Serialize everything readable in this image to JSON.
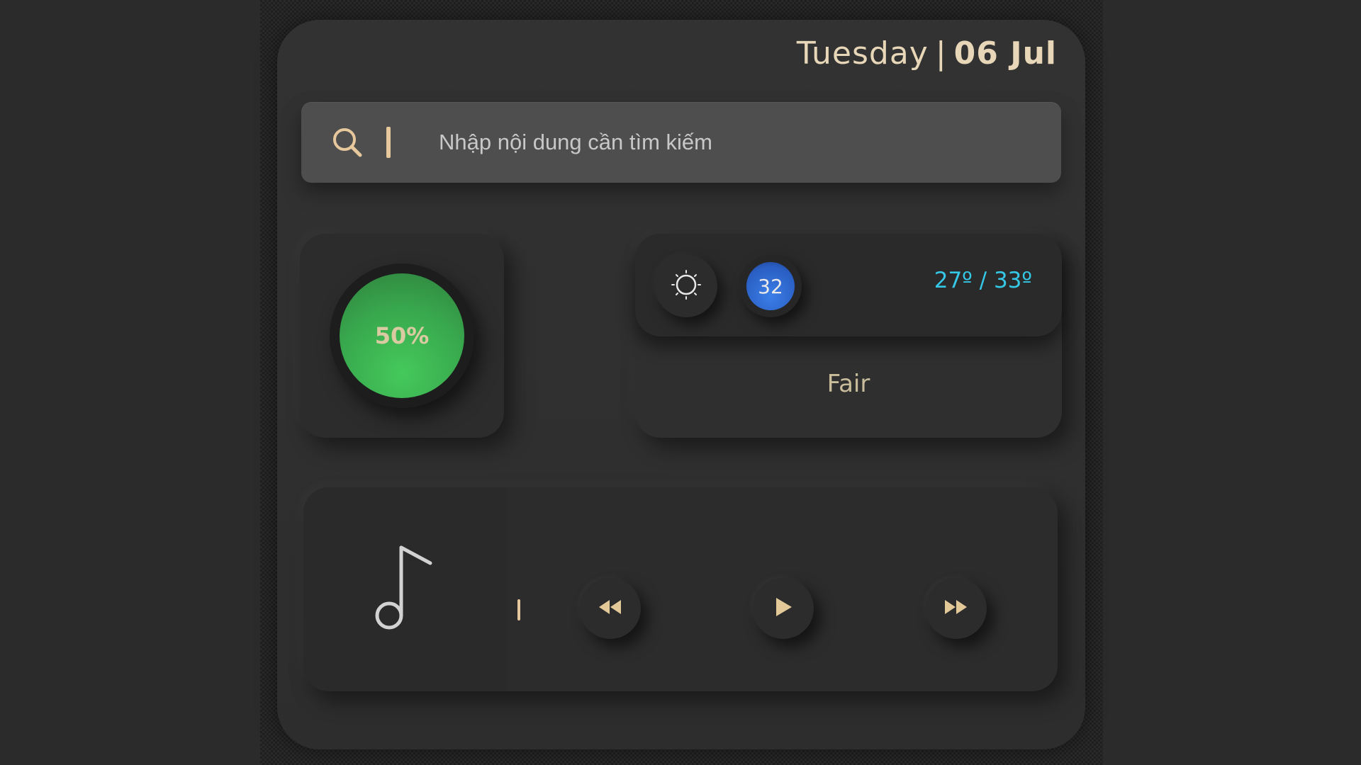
{
  "header": {
    "weekday": "Tuesday",
    "separator": "|",
    "day_month": "06 Jul"
  },
  "search": {
    "placeholder": "Nhập nội dung cần tìm kiếm",
    "value": ""
  },
  "battery": {
    "label": "50%",
    "level": 0.5
  },
  "weather": {
    "current_temp": "32",
    "range": "27º / 33º",
    "condition": "Fair"
  },
  "icons": {
    "search": "search-icon",
    "sun": "sun-icon",
    "music": "music-note-icon",
    "prev": "rewind-icon",
    "play": "play-icon",
    "next": "fast-forward-icon"
  },
  "colors": {
    "accent": "#e7c89c",
    "gauge_green": "#3cb04f",
    "temp_blue": "#2a5ec2",
    "range_cyan": "#35c8e6"
  }
}
